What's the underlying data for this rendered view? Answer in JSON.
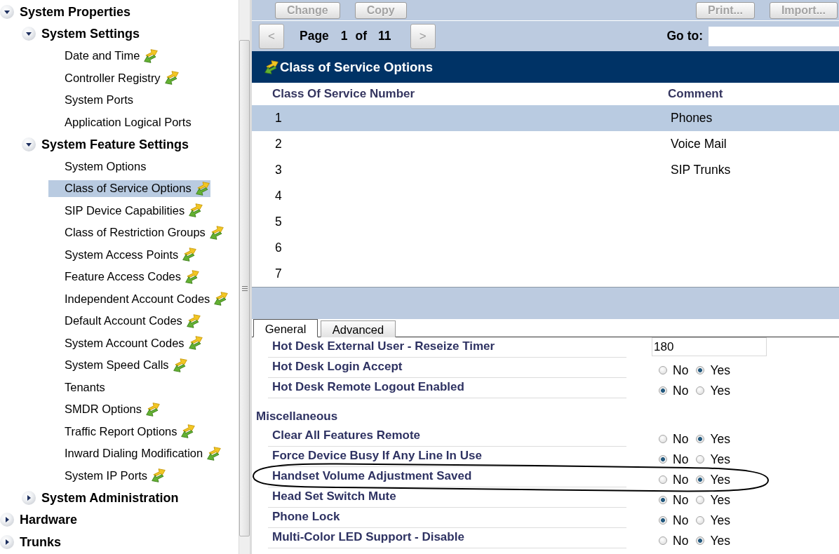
{
  "tree": [
    {
      "kind": "folder",
      "label": "System Properties",
      "expanded": true,
      "selected": false,
      "children": [
        {
          "kind": "folder",
          "label": "System Settings",
          "expanded": true,
          "selected": false,
          "children": [
            {
              "kind": "page",
              "label": "Date and Time",
              "shared": true,
              "selected": false
            },
            {
              "kind": "page",
              "label": "Controller Registry",
              "shared": true,
              "selected": false
            },
            {
              "kind": "page",
              "label": "System Ports",
              "shared": false,
              "selected": false
            },
            {
              "kind": "page",
              "label": "Application Logical Ports",
              "shared": false,
              "selected": false
            }
          ]
        },
        {
          "kind": "folder",
          "label": "System Feature Settings",
          "expanded": true,
          "selected": false,
          "children": [
            {
              "kind": "page",
              "label": "System Options",
              "shared": false,
              "selected": false
            },
            {
              "kind": "page",
              "label": "Class of Service Options",
              "shared": true,
              "selected": true
            },
            {
              "kind": "page",
              "label": "SIP Device Capabilities",
              "shared": true,
              "selected": false
            },
            {
              "kind": "page",
              "label": "Class of Restriction Groups",
              "shared": true,
              "selected": false
            },
            {
              "kind": "page",
              "label": "System Access Points",
              "shared": true,
              "selected": false
            },
            {
              "kind": "page",
              "label": "Feature Access Codes",
              "shared": true,
              "selected": false
            },
            {
              "kind": "page",
              "label": "Independent Account Codes",
              "shared": true,
              "selected": false
            },
            {
              "kind": "page",
              "label": "Default Account Codes",
              "shared": true,
              "selected": false
            },
            {
              "kind": "page",
              "label": "System Account Codes",
              "shared": true,
              "selected": false
            },
            {
              "kind": "page",
              "label": "System Speed Calls",
              "shared": true,
              "selected": false
            },
            {
              "kind": "page",
              "label": "Tenants",
              "shared": false,
              "selected": false
            },
            {
              "kind": "page",
              "label": "SMDR Options",
              "shared": true,
              "selected": false
            },
            {
              "kind": "page",
              "label": "Traffic Report Options",
              "shared": true,
              "selected": false
            },
            {
              "kind": "page",
              "label": "Inward Dialing Modification",
              "shared": true,
              "selected": false
            },
            {
              "kind": "page",
              "label": "System IP Ports",
              "shared": true,
              "selected": false
            }
          ]
        },
        {
          "kind": "folder",
          "label": "System Administration",
          "expanded": false,
          "selected": false
        }
      ]
    },
    {
      "kind": "folder",
      "label": "Hardware",
      "expanded": false,
      "selected": false
    },
    {
      "kind": "folder",
      "label": "Trunks",
      "expanded": false,
      "selected": false
    }
  ],
  "toolbar": {
    "left_buttons": [
      {
        "label": "Change",
        "disabled": true
      },
      {
        "label": "Copy",
        "disabled": true
      }
    ],
    "right_buttons": [
      {
        "label": "Print...",
        "disabled": true
      },
      {
        "label": "Import...",
        "disabled": true
      }
    ]
  },
  "pager": {
    "previous": "<",
    "page_label": "Page",
    "page": "1",
    "of_label": "of",
    "page_count": "11",
    "next": ">",
    "goto_label": "Go to:"
  },
  "grid": {
    "title": "Class of Service Options",
    "shared": true,
    "columns": [
      "Class Of Service Number",
      "Comment"
    ],
    "rows": [
      {
        "number": "1",
        "comment": "Phones",
        "selected": true
      },
      {
        "number": "2",
        "comment": "Voice Mail",
        "selected": false
      },
      {
        "number": "3",
        "comment": "SIP Trunks",
        "selected": false
      },
      {
        "number": "4",
        "selected": false
      },
      {
        "number": "5",
        "selected": false
      },
      {
        "number": "6",
        "selected": false
      },
      {
        "number": "7",
        "selected": false
      }
    ]
  },
  "tabs": [
    {
      "label": "General",
      "selected": true
    },
    {
      "label": "Advanced",
      "selected": false
    }
  ],
  "form": {
    "groups": [
      {
        "rows": [
          {
            "kind": "text",
            "label": "Hot Desk External User - Reseize Timer",
            "value": "180",
            "circled": false
          },
          {
            "kind": "radio",
            "label": "Hot Desk Login Accept",
            "options": [
              {
                "label": "No",
                "selected": false
              },
              {
                "label": "Yes",
                "selected": true
              }
            ],
            "circled": false
          },
          {
            "kind": "radio",
            "label": "Hot Desk Remote Logout Enabled",
            "options": [
              {
                "label": "No",
                "selected": true
              },
              {
                "label": "Yes",
                "selected": false
              }
            ],
            "circled": false
          }
        ]
      },
      {
        "heading": "Miscellaneous",
        "rows": [
          {
            "kind": "radio",
            "label": "Clear All Features Remote",
            "options": [
              {
                "label": "No",
                "selected": false
              },
              {
                "label": "Yes",
                "selected": true
              }
            ],
            "circled": false
          },
          {
            "kind": "radio",
            "label": "Force Device Busy If Any Line In Use",
            "options": [
              {
                "label": "No",
                "selected": true
              },
              {
                "label": "Yes",
                "selected": false
              }
            ],
            "circled": false
          },
          {
            "kind": "radio",
            "label": "Handset Volume Adjustment Saved",
            "options": [
              {
                "label": "No",
                "selected": false
              },
              {
                "label": "Yes",
                "selected": true
              }
            ],
            "circled": true
          },
          {
            "kind": "radio",
            "label": "Head Set Switch Mute",
            "options": [
              {
                "label": "No",
                "selected": true
              },
              {
                "label": "Yes",
                "selected": false
              }
            ],
            "circled": false
          },
          {
            "kind": "radio",
            "label": "Phone Lock",
            "options": [
              {
                "label": "No",
                "selected": true
              },
              {
                "label": "Yes",
                "selected": false
              }
            ],
            "circled": false
          },
          {
            "kind": "radio",
            "label": "Multi-Color LED Support - Disable",
            "options": [
              {
                "label": "No",
                "selected": false
              },
              {
                "label": "Yes",
                "selected": true
              }
            ],
            "circled": false
          }
        ]
      }
    ]
  }
}
